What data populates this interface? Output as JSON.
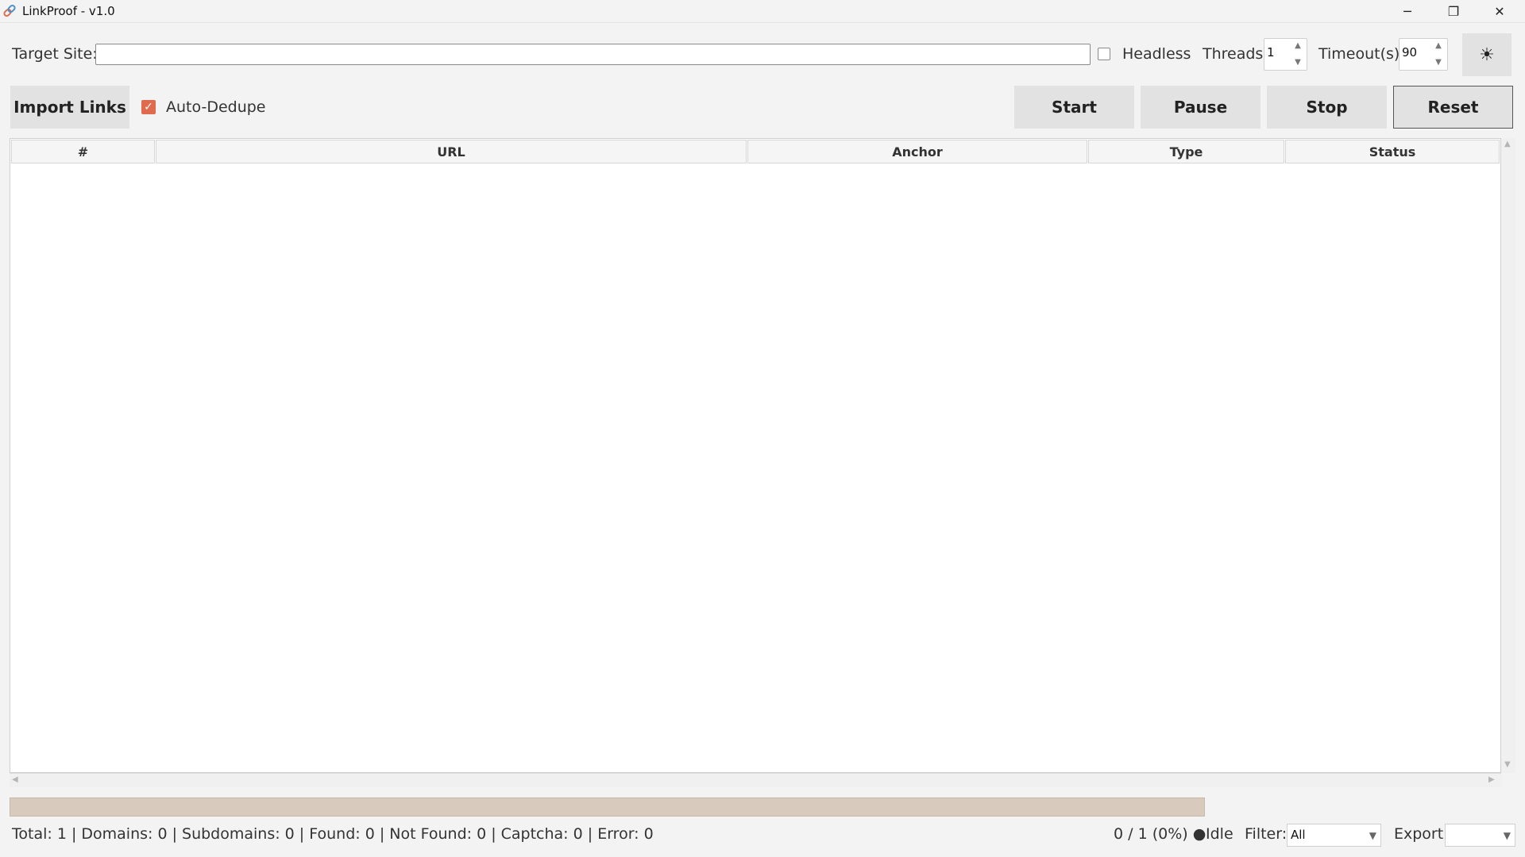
{
  "window": {
    "title": "LinkProof - v1.0",
    "minimize_glyph": "─",
    "restore_glyph": "❐",
    "close_glyph": "✕"
  },
  "target": {
    "label": "Target Site:",
    "value": "",
    "headless_label": "Headless",
    "headless_checked": false,
    "threads_label": "Threads:",
    "threads_value": "1",
    "timeout_label": "Timeout(s):",
    "timeout_value": "90",
    "theme_icon": "sun-icon",
    "theme_glyph": "☀"
  },
  "toolbar": {
    "import_label": "Import Links",
    "dedupe_label": "Auto-Dedupe",
    "dedupe_checked": true,
    "start_label": "Start",
    "pause_label": "Pause",
    "stop_label": "Stop",
    "reset_label": "Reset"
  },
  "table": {
    "columns": [
      "#",
      "URL",
      "Anchor",
      "Type",
      "Status"
    ],
    "rows": []
  },
  "progress": {
    "fraction": 0
  },
  "status": {
    "summary": "Total: 1 | Domains: 0 | Subdomains: 0 | Found: 0 | Not Found: 0 | Captcha: 0 | Error: 0",
    "progress_text": "0 / 1 (0%) ●",
    "state": "Idle",
    "filter_label": "Filter:",
    "filter_value": "All",
    "export_label": "Export:",
    "export_value": ""
  },
  "colors": {
    "accent": "#e06a4e",
    "progress_track": "#d8cbbd",
    "button_bg": "#e2e2e2",
    "window_bg": "#f3f3f3"
  }
}
